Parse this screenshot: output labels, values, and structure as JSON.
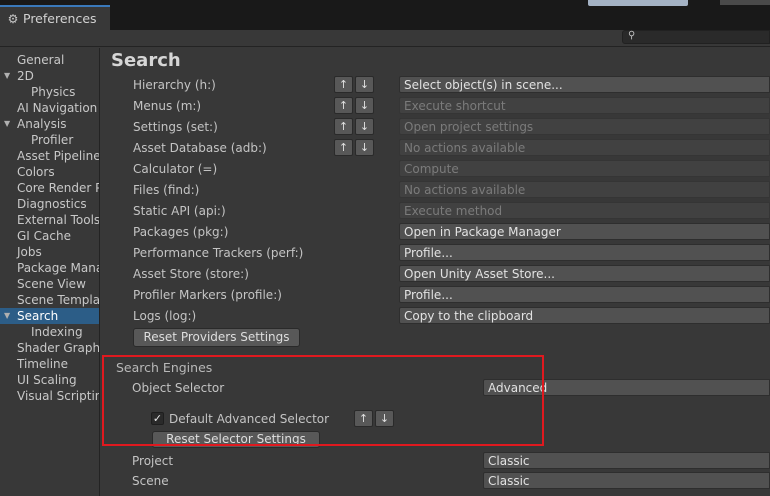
{
  "window": {
    "tab_title": "Preferences",
    "tab_icon": "gear-icon",
    "search_icon": "search-icon"
  },
  "sidebar": {
    "items": [
      {
        "label": "General",
        "indent": 1
      },
      {
        "label": "2D",
        "indent": 1,
        "expanded": true
      },
      {
        "label": "Physics",
        "indent": 2
      },
      {
        "label": "AI Navigation",
        "indent": 1
      },
      {
        "label": "Analysis",
        "indent": 1,
        "expanded": true
      },
      {
        "label": "Profiler",
        "indent": 2
      },
      {
        "label": "Asset Pipeline",
        "indent": 1
      },
      {
        "label": "Colors",
        "indent": 1
      },
      {
        "label": "Core Render Pipeline",
        "indent": 1
      },
      {
        "label": "Diagnostics",
        "indent": 1
      },
      {
        "label": "External Tools",
        "indent": 1
      },
      {
        "label": "GI Cache",
        "indent": 1
      },
      {
        "label": "Jobs",
        "indent": 1
      },
      {
        "label": "Package Manager",
        "indent": 1
      },
      {
        "label": "Scene View",
        "indent": 1
      },
      {
        "label": "Scene Template",
        "indent": 1
      },
      {
        "label": "Search",
        "indent": 1,
        "expanded": true,
        "selected": true
      },
      {
        "label": "Indexing",
        "indent": 2
      },
      {
        "label": "Shader Graph",
        "indent": 1
      },
      {
        "label": "Timeline",
        "indent": 1
      },
      {
        "label": "UI Scaling",
        "indent": 1
      },
      {
        "label": "Visual Scripting",
        "indent": 1
      }
    ]
  },
  "main": {
    "title": "Search",
    "providers": [
      {
        "label": "Hierarchy (h:)",
        "arrows": true,
        "action": "Select object(s) in scene...",
        "enabled": true
      },
      {
        "label": "Menus (m:)",
        "arrows": true,
        "action": "Execute shortcut",
        "enabled": false
      },
      {
        "label": "Settings (set:)",
        "arrows": true,
        "action": "Open project settings",
        "enabled": false
      },
      {
        "label": "Asset Database (adb:)",
        "arrows": true,
        "action": "No actions available",
        "enabled": false
      },
      {
        "label": "Calculator (=)",
        "arrows": false,
        "action": "Compute",
        "enabled": false
      },
      {
        "label": "Files (find:)",
        "arrows": false,
        "action": "No actions available",
        "enabled": false
      },
      {
        "label": "Static API (api:)",
        "arrows": false,
        "action": "Execute method",
        "enabled": false
      },
      {
        "label": "Packages (pkg:)",
        "arrows": false,
        "action": "Open in Package Manager",
        "enabled": true
      },
      {
        "label": "Performance Trackers (perf:)",
        "arrows": false,
        "action": "Profile...",
        "enabled": true
      },
      {
        "label": "Asset Store (store:)",
        "arrows": false,
        "action": "Open Unity Asset Store...",
        "enabled": true
      },
      {
        "label": "Profiler Markers (profile:)",
        "arrows": false,
        "action": "Profile...",
        "enabled": true
      },
      {
        "label": "Logs (log:)",
        "arrows": false,
        "action": "Copy to the clipboard",
        "enabled": true
      }
    ],
    "arrow_up": "↑",
    "arrow_down": "↓",
    "reset_providers_label": "Reset Providers Settings",
    "engines": {
      "title": "Search Engines",
      "object_selector_label": "Object Selector",
      "object_selector_value": "Advanced",
      "default_advanced_label": "Default Advanced Selector",
      "default_advanced_checked": true,
      "checkmark": "✓",
      "reset_selector_label": "Reset Selector Settings",
      "project_label": "Project",
      "project_value": "Classic",
      "scene_label": "Scene",
      "scene_value": "Classic"
    }
  },
  "colors": {
    "highlight_box": "#e0191f",
    "selection": "#2c5d87",
    "tab_accent": "#3a79bb"
  }
}
